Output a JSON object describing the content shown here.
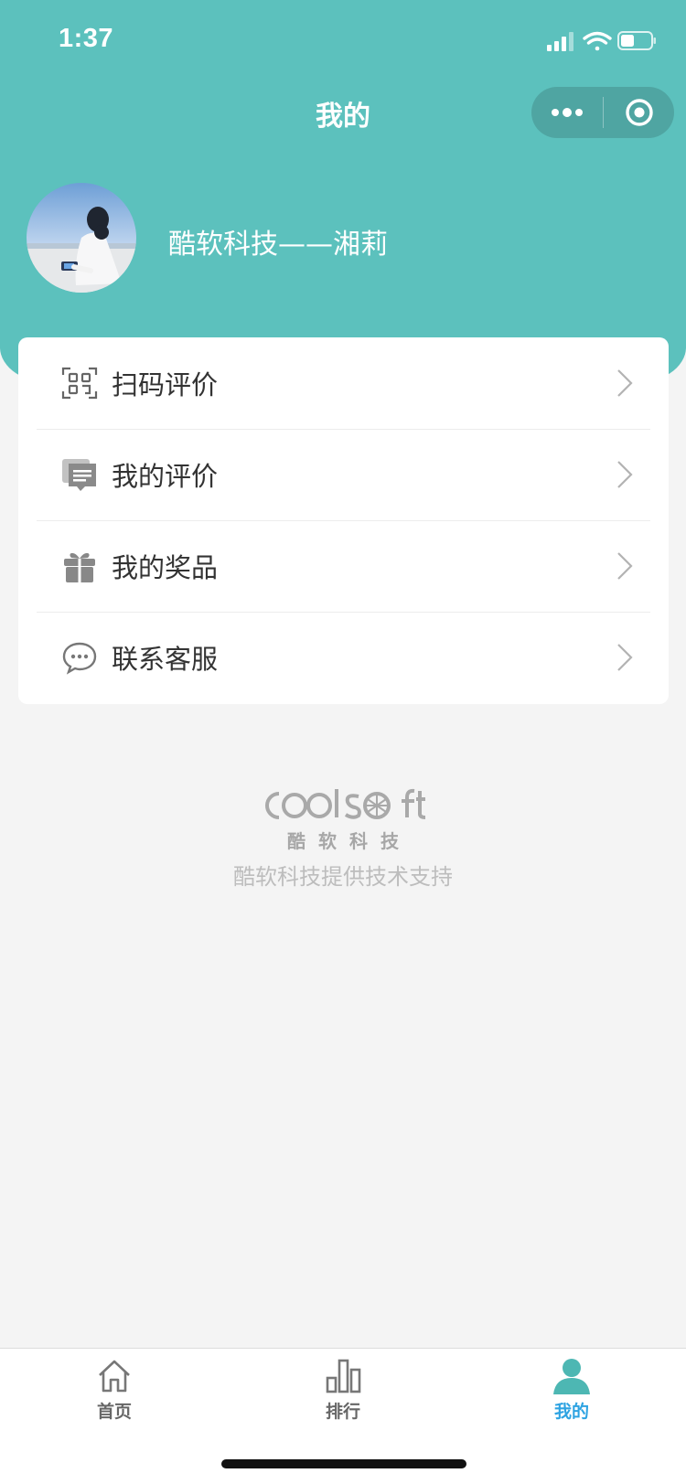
{
  "status_bar": {
    "time": "1:37"
  },
  "nav": {
    "title": "我的",
    "more_icon": "more-dots-icon",
    "target_icon": "target-icon"
  },
  "profile": {
    "username": "酷软科技——湘莉",
    "avatar": "user-avatar-photo"
  },
  "menu": {
    "items": [
      {
        "label": "扫码评价",
        "icon": "qr-scan-icon"
      },
      {
        "label": "我的评价",
        "icon": "comment-list-icon"
      },
      {
        "label": "我的奖品",
        "icon": "gift-icon"
      },
      {
        "label": "联系客服",
        "icon": "chat-bubble-icon"
      }
    ]
  },
  "brand": {
    "logo_text": "COOLSOFT",
    "cn_name": "酷软科技",
    "support": "酷软科技提供技术支持"
  },
  "tabbar": {
    "items": [
      {
        "label": "首页",
        "icon": "home-icon"
      },
      {
        "label": "排行",
        "icon": "ranking-bars-icon"
      },
      {
        "label": "我的",
        "icon": "user-icon",
        "active": true
      }
    ]
  },
  "colors": {
    "primary": "#5cc1bd",
    "active_tab": "#2ea3e2",
    "background": "#f4f4f4"
  }
}
